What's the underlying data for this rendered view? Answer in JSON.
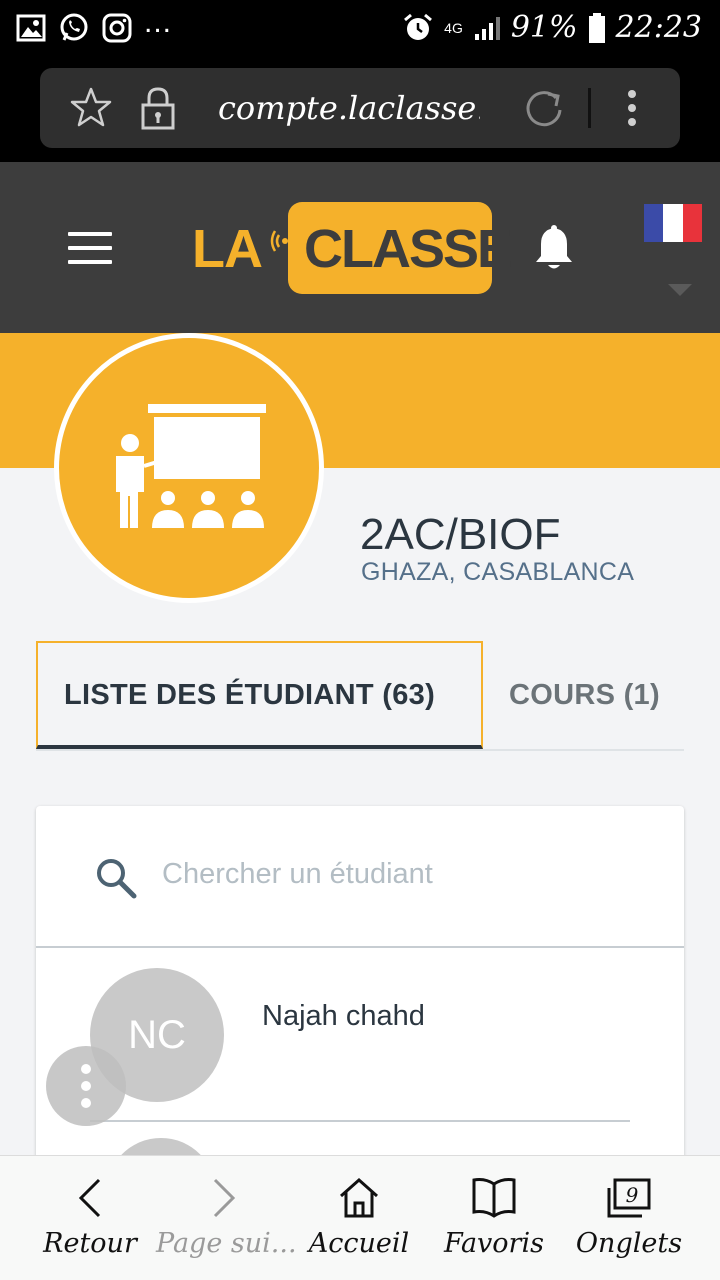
{
  "status_bar": {
    "more": "...",
    "network": "4G",
    "battery": "91%",
    "time": "22:23"
  },
  "browser": {
    "url": "compte.laclasse.ma"
  },
  "header": {
    "logo_left": "LA",
    "logo_right": "CLASSE",
    "flag_colors": [
      "#3b4ba8",
      "#ffffff",
      "#e8333b"
    ]
  },
  "class_info": {
    "name": "2AC/BIOF",
    "location": "GHAZA, CASABLANCA"
  },
  "tabs": [
    {
      "label": "LISTE DES ÉTUDIANT (63)",
      "active": true
    },
    {
      "label": "COURS (1)",
      "active": false
    }
  ],
  "search": {
    "placeholder": "Chercher un étudiant"
  },
  "students": [
    {
      "initials": "NC",
      "name": "Najah chahd"
    }
  ],
  "bottom_nav": [
    {
      "label": "Retour",
      "icon": "chevron-left-icon",
      "enabled": true
    },
    {
      "label": "Page sui...",
      "icon": "chevron-right-icon",
      "enabled": false
    },
    {
      "label": "Accueil",
      "icon": "home-icon",
      "enabled": true
    },
    {
      "label": "Favoris",
      "icon": "book-icon",
      "enabled": true
    },
    {
      "label": "Onglets",
      "icon": "tabs-icon",
      "enabled": true,
      "count": "9"
    }
  ],
  "colors": {
    "accent": "#f5b12b",
    "header_bg": "#3d3d3d",
    "text_dark": "#2b3640",
    "text_muted": "#55708a"
  }
}
